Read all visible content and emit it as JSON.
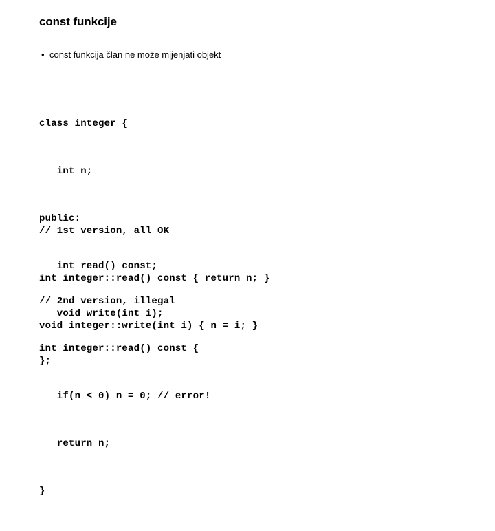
{
  "slide": {
    "title": "const funkcije",
    "bullets": [
      {
        "marker": "•",
        "text": "const funkcija član ne može mijenjati objekt"
      }
    ],
    "code_blocks": [
      {
        "name": "class-definition",
        "lines": [
          "class integer {",
          "   int n;",
          "public:",
          "   int read() const;",
          "   void write(int i);",
          "};"
        ]
      },
      {
        "name": "first-version-ok",
        "lines": [
          "// 1st version, all OK",
          "int integer::read() const { return n; }",
          "void integer::write(int i) { n = i; }"
        ]
      },
      {
        "name": "second-version-illegal",
        "lines": [
          "// 2nd version, illegal",
          "int integer::read() const {",
          "   if(n < 0) n = 0; // error!",
          "   return n;",
          "}"
        ]
      }
    ]
  },
  "colors": {
    "background": "#ffffff",
    "text": "#000000"
  }
}
